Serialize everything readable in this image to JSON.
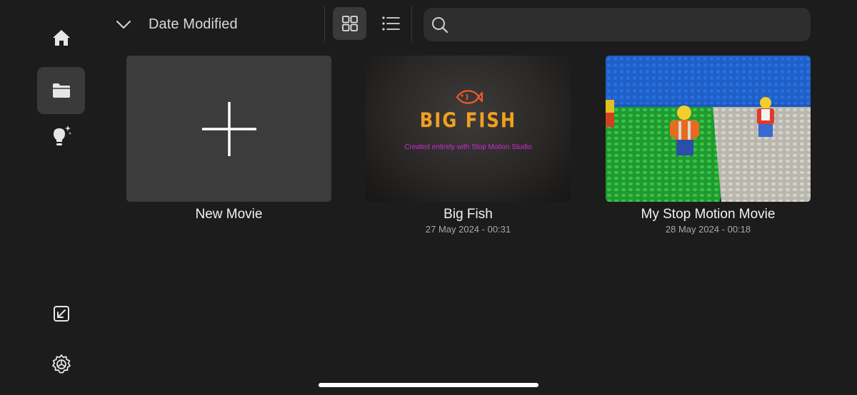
{
  "sidebar": {
    "items": [
      {
        "name": "home",
        "icon": "home-icon"
      },
      {
        "name": "projects",
        "icon": "folder-icon",
        "active": true
      },
      {
        "name": "ideas",
        "icon": "lightbulb-icon"
      },
      {
        "name": "import",
        "icon": "import-icon"
      },
      {
        "name": "settings",
        "icon": "settings-icon"
      }
    ]
  },
  "toolbar": {
    "sort_label": "Date Modified",
    "view_mode": "grid",
    "search_placeholder": ""
  },
  "movies": [
    {
      "title": "New Movie",
      "date": ""
    },
    {
      "title": "Big Fish",
      "date": "27 May 2024 - 00:31",
      "thumb_title": "BIG FISH",
      "thumb_subtitle": "Created entirely with Stop Motion Studio"
    },
    {
      "title": "My Stop Motion Movie",
      "date": "28 May 2024 - 00:18"
    }
  ],
  "colors": {
    "background": "#1c1c1c",
    "selected": "#3a3a3a",
    "accent_orange": "#f0a020",
    "accent_magenta": "#d32ad8"
  }
}
